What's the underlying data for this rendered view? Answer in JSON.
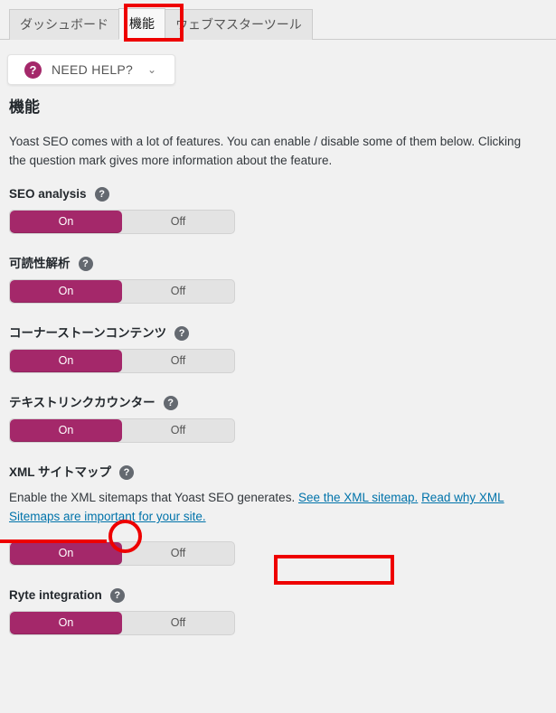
{
  "tabs": [
    {
      "label": "ダッシュボード",
      "active": false
    },
    {
      "label": "機能",
      "active": true
    },
    {
      "label": "ウェブマスターツール",
      "active": false
    }
  ],
  "need_help": {
    "icon": "question-mark-icon",
    "label": "NEED HELP?",
    "chevron": "⌄"
  },
  "page": {
    "title": "機能",
    "intro": "Yoast SEO comes with a lot of features. You can enable / disable some of them below. Clicking the question mark gives more information about the feature."
  },
  "help_icon_glyph": "?",
  "toggle": {
    "on_label": "On",
    "off_label": "Off"
  },
  "features": [
    {
      "name": "seo-analysis",
      "label": "SEO analysis",
      "state": "On"
    },
    {
      "name": "readability-analysis",
      "label": "可読性解析",
      "state": "On"
    },
    {
      "name": "cornerstone-content",
      "label": "コーナーストーンコンテンツ",
      "state": "On"
    },
    {
      "name": "text-link-counter",
      "label": "テキストリンクカウンター",
      "state": "On"
    },
    {
      "name": "xml-sitemaps",
      "label": "XML サイトマップ",
      "state": "On"
    },
    {
      "name": "ryte-integration",
      "label": "Ryte integration",
      "state": "On"
    }
  ],
  "xml_sitemaps_description": {
    "text_before": "Enable the XML sitemaps that Yoast SEO generates.",
    "link_sitemap": "See the XML sitemap.",
    "link_read_why": "Read why XML Sitemaps are important for your site."
  },
  "colors": {
    "accent_magenta": "#a4286a",
    "link_blue": "#0073aa",
    "annotation_red": "#ee0000",
    "page_background": "#f1f1f1",
    "help_icon_gray": "#646970"
  },
  "annotations": [
    {
      "name": "annotation-box-tab-features",
      "shape": "box"
    },
    {
      "name": "annotation-underline-xml-sitemaps",
      "shape": "underline"
    },
    {
      "name": "annotation-circle-xml-help-icon",
      "shape": "circle"
    },
    {
      "name": "annotation-box-see-xml-sitemap-link",
      "shape": "box"
    }
  ]
}
